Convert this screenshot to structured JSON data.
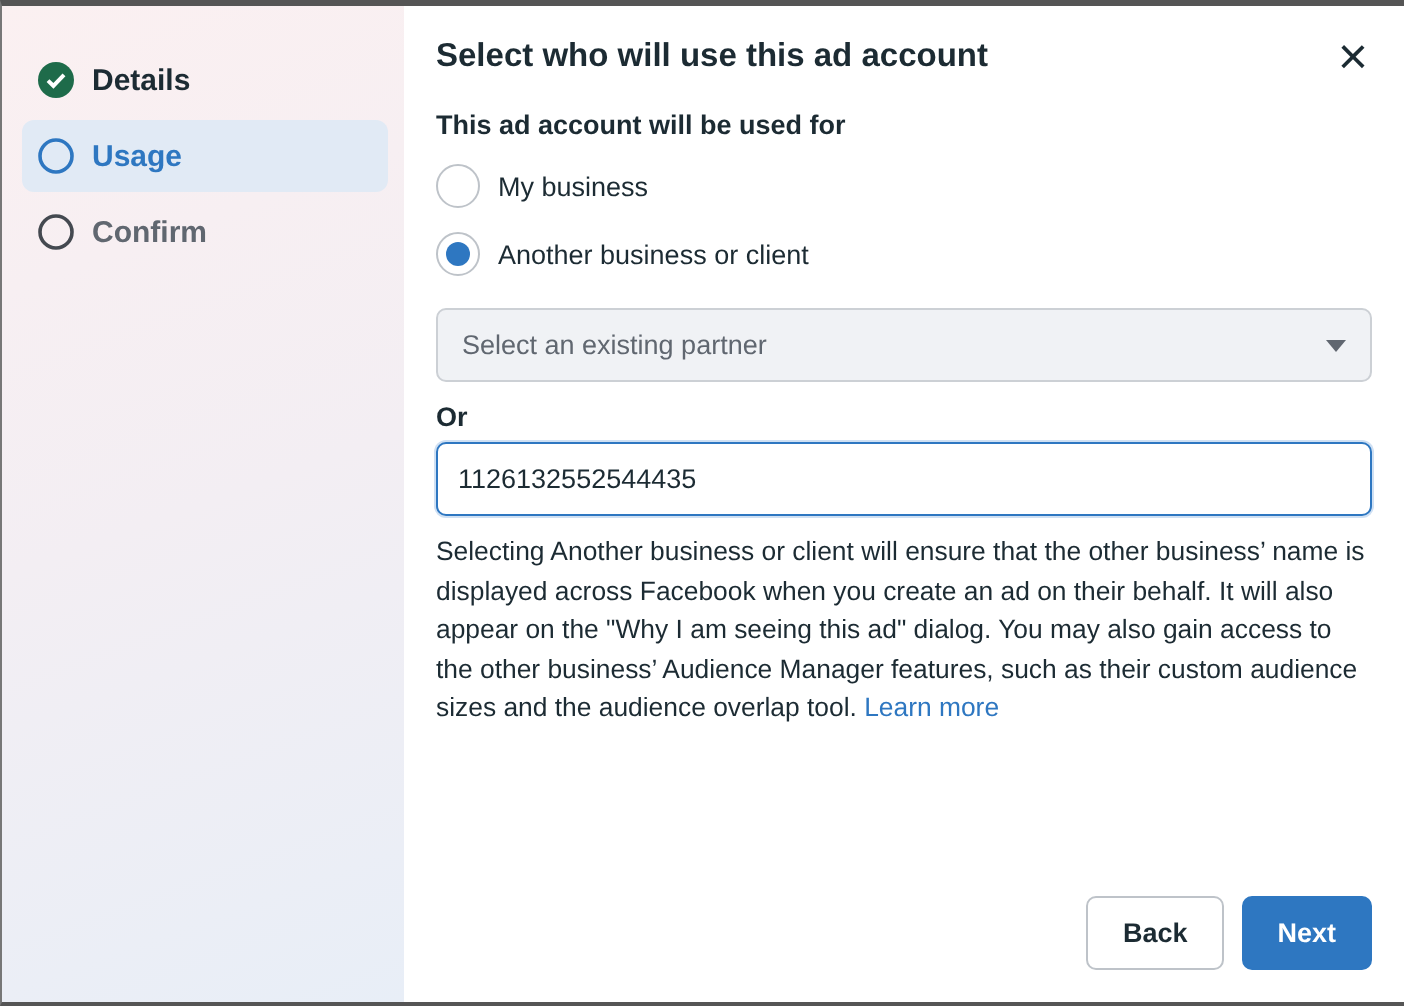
{
  "steps": [
    {
      "label": "Details",
      "kind": "done",
      "selected": false
    },
    {
      "label": "Usage",
      "kind": "current",
      "selected": true
    },
    {
      "label": "Confirm",
      "kind": "pending",
      "selected": false
    }
  ],
  "dialog": {
    "title": "Select who will use this ad account",
    "close": "×",
    "question": "This ad account will be used for",
    "options": [
      {
        "label": "My business",
        "selected": false
      },
      {
        "label": "Another business or client",
        "selected": true
      }
    ],
    "partner_select": {
      "placeholder": "Select an existing partner"
    },
    "or_label": "Or",
    "id_field": {
      "value": "1126132552544435"
    },
    "description": {
      "text": "Selecting Another business or client will ensure that the other business’ name is displayed across Facebook when you create an ad on their behalf. It will also appear on the \"Why I am seeing this ad\" dialog. You may also gain access to the other business’ Audience Manager features, such as their custom audience sizes and the audience overlap tool.",
      "link": "Learn more"
    },
    "buttons": [
      {
        "label": "Back",
        "kind": "secondary"
      },
      {
        "label": "Next",
        "kind": "primary"
      }
    ]
  }
}
